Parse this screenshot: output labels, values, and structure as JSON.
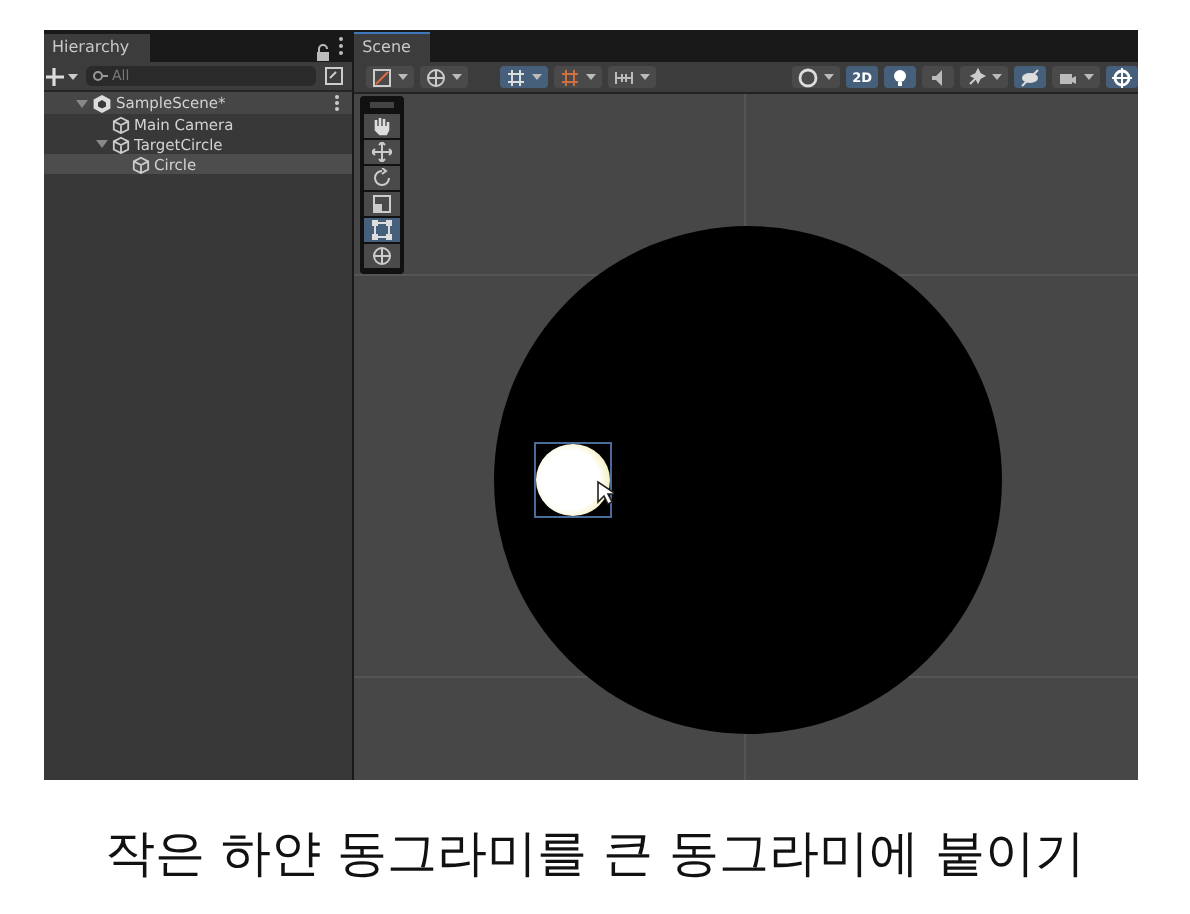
{
  "hierarchy": {
    "title": "Hierarchy",
    "search": {
      "placeholder": "All"
    },
    "tree": [
      {
        "label": "SampleScene*",
        "kind": "scene",
        "expanded": true,
        "selected": false,
        "children": [
          {
            "label": "Main Camera",
            "kind": "object",
            "selected": false
          },
          {
            "label": "TargetCircle",
            "kind": "object",
            "expanded": true,
            "selected": false,
            "children": [
              {
                "label": "Circle",
                "kind": "object",
                "selected": true
              }
            ]
          }
        ]
      }
    ]
  },
  "scene": {
    "tab": "Scene",
    "toolbar": [
      {
        "kind": "shading",
        "on": false,
        "dropdown": true
      },
      {
        "kind": "globe",
        "on": false,
        "dropdown": true
      },
      {
        "kind": "grid-snap",
        "on": true,
        "dropdown": true
      },
      {
        "kind": "snap",
        "on": false,
        "dropdown": true
      },
      {
        "kind": "increment",
        "on": false,
        "dropdown": true
      },
      {
        "kind": "sphere",
        "on": false,
        "dropdown": true
      },
      {
        "kind": "text",
        "label": "2D",
        "on": true,
        "dropdown": false
      },
      {
        "kind": "light",
        "on": true,
        "dropdown": false
      },
      {
        "kind": "audio",
        "on": false,
        "dropdown": false
      },
      {
        "kind": "effects",
        "on": false,
        "dropdown": true
      },
      {
        "kind": "hidden",
        "on": true,
        "dropdown": false
      },
      {
        "kind": "camera",
        "on": false,
        "dropdown": true
      },
      {
        "kind": "gizmo",
        "on": true,
        "dropdown": false
      }
    ],
    "tools": [
      {
        "kind": "hand",
        "selected": false
      },
      {
        "kind": "move",
        "selected": false
      },
      {
        "kind": "rotate",
        "selected": false
      },
      {
        "kind": "scale",
        "selected": false
      },
      {
        "kind": "rect",
        "selected": true
      },
      {
        "kind": "transform",
        "selected": false
      }
    ]
  },
  "caption": "작은 하얀 동그라미를 큰 동그라미에 붙이기"
}
